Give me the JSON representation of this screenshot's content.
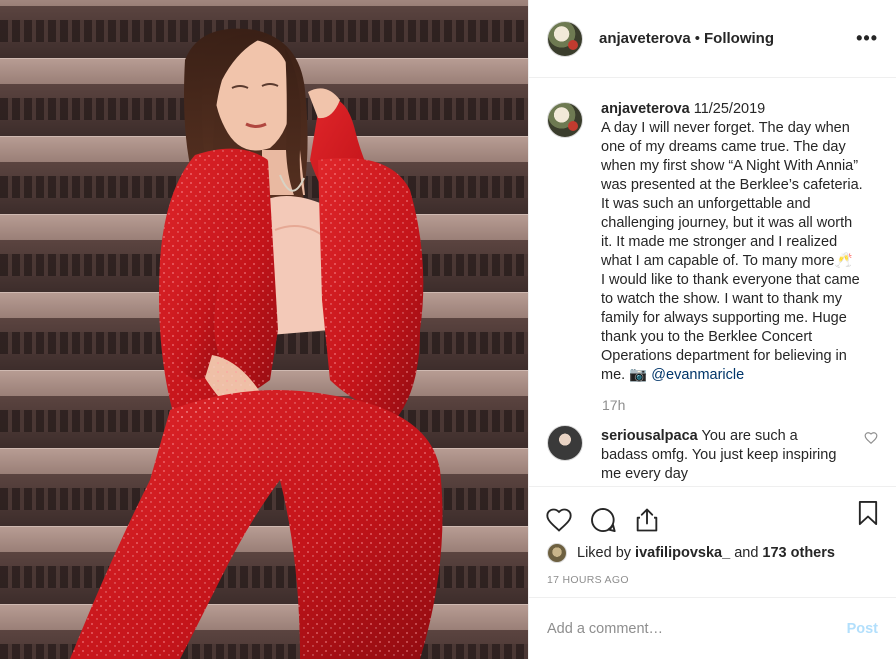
{
  "post": {
    "username": "anjaveterova",
    "follow_status": "Following",
    "separator": "•",
    "more_icon": "more-dots-icon",
    "caption": {
      "username": "anjaveterova",
      "date": "11/25/2019",
      "text_1": "A day I will never forget. The day when one of my dreams came true. The day when my first show “A Night With Annia” was presented at the Berklee’s cafeteria. It was such an unforgettable and challenging journey, but it was all worth it. It made me stronger and I realized what I am capable of. To many more🥂",
      "text_2": "I would like to thank everyone that came to watch the show. I want to thank my family for always supporting me. Huge thank you to the Berklee Concert Operations department for believing in me. 📷",
      "mention": "@evanmaricle",
      "time_ago": "17h"
    },
    "comments": [
      {
        "username": "seriousalpaca",
        "text": "You are such a badass omfg. You just keep inspiring me every day"
      }
    ],
    "likes": {
      "prefix": "Liked by",
      "user": "ivafilipovska_",
      "and": "and",
      "others": "173 others"
    },
    "timestamp": "17 hours ago",
    "add_comment": {
      "placeholder": "Add a comment…",
      "post_label": "Post"
    }
  },
  "colors": {
    "text": "#262626",
    "muted": "#8e8e8e",
    "mention": "#003569",
    "post_button_disabled": "#b2dffc",
    "suit_red": "#d0171b"
  }
}
